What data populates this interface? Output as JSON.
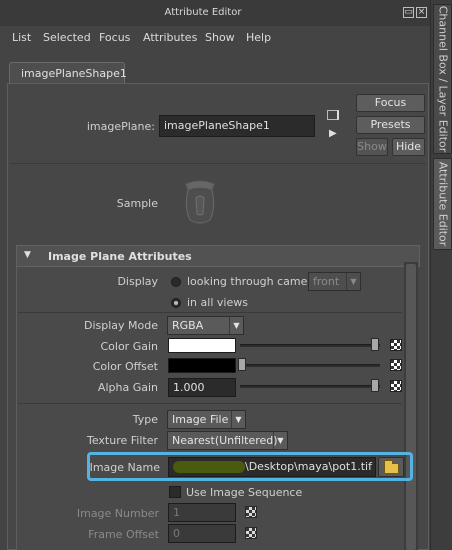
{
  "window": {
    "title": "Attribute Editor"
  },
  "right_tabs": [
    "Channel Box / Layer Editor",
    "Attribute Editor"
  ],
  "menu": [
    "List",
    "Selected",
    "Focus",
    "Attributes",
    "Show",
    "Help"
  ],
  "node_tab": "imagePlaneShape1",
  "header": {
    "node_type_label": "imagePlane:",
    "node_name": "imagePlaneShape1",
    "focus": "Focus",
    "presets": "Presets",
    "show": "Show",
    "hide": "Hide"
  },
  "sample_label": "Sample",
  "section": {
    "title": "Image Plane Attributes",
    "display_label": "Display",
    "display_option1": "looking through camera",
    "display_camera": "front",
    "display_option2": "in all views",
    "display_mode_label": "Display Mode",
    "display_mode": "RGBA",
    "color_gain_label": "Color Gain",
    "color_gain_color": "#ffffff",
    "color_offset_label": "Color Offset",
    "color_offset_color": "#000000",
    "alpha_gain_label": "Alpha Gain",
    "alpha_gain": "1.000",
    "type_label": "Type",
    "type": "Image File",
    "texture_filter_label": "Texture Filter",
    "texture_filter": "Nearest(Unfiltered)",
    "image_name_label": "Image Name",
    "image_name": "\\Desktop\\maya\\pot1.tif",
    "use_image_sequence": "Use Image Sequence",
    "image_number_label": "Image Number",
    "image_number": "1",
    "frame_offset_label": "Frame Offset",
    "frame_offset": "0"
  },
  "colors": {
    "highlight": "#54b3e3",
    "redaction": "#4a5a0f"
  }
}
